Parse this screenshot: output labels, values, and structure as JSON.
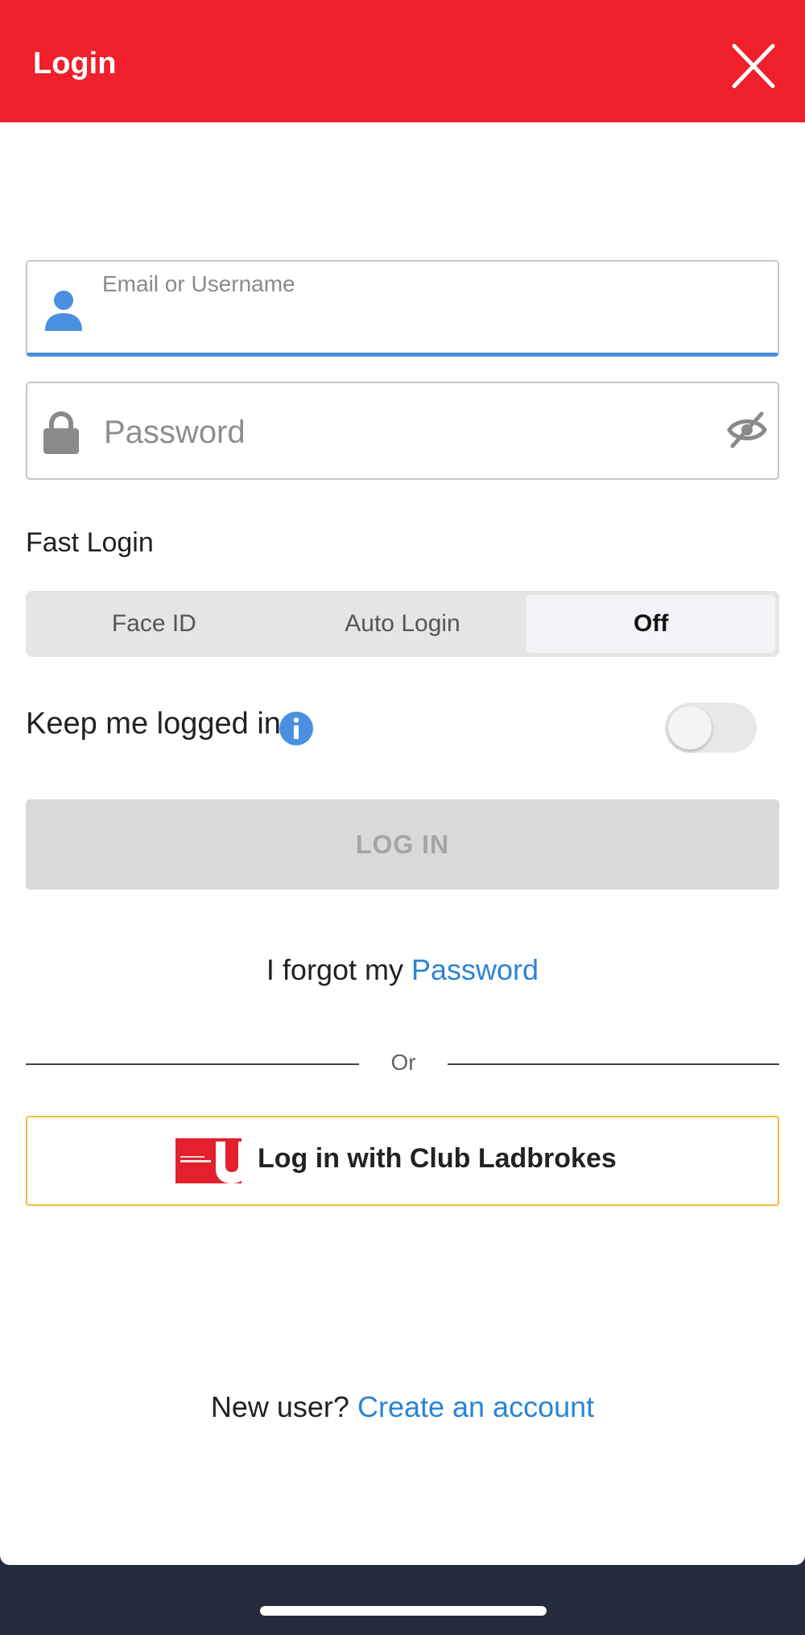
{
  "header": {
    "title": "Login",
    "close_icon": "close-icon"
  },
  "form": {
    "email_label": "Email or Username",
    "email_value": "",
    "password_placeholder": "Password",
    "password_value": "",
    "user_icon": "user-icon",
    "lock_icon": "lock-icon",
    "visibility_icon": "eye-off-icon"
  },
  "fast_login": {
    "label": "Fast Login",
    "options": [
      "Face ID",
      "Auto Login",
      "Off"
    ],
    "selected": "Off"
  },
  "keep_logged_in": {
    "label": "Keep me logged in",
    "info_icon": "info-icon",
    "enabled": false
  },
  "login_button": {
    "label": "LOG IN",
    "disabled": true
  },
  "forgot": {
    "prefix": "I forgot my",
    "link": "Password"
  },
  "divider": {
    "text": "Or"
  },
  "club_login": {
    "label": "Log in with Club Ladbrokes",
    "logo": "club-ladbrokes-logo"
  },
  "signup": {
    "prefix": "New user?",
    "link": "Create an account"
  },
  "colors": {
    "header": "#ef1f2b",
    "accent_blue": "#2a84d8",
    "club_border": "#f0bd3a"
  }
}
